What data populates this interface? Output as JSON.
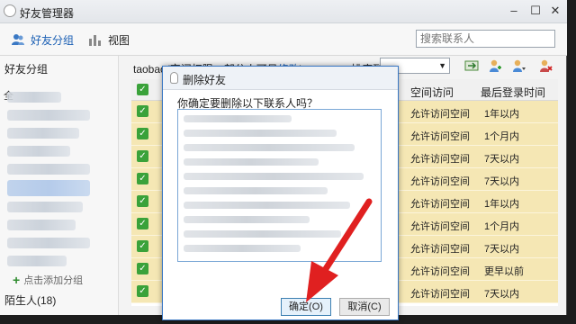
{
  "window": {
    "title": "好友管理器",
    "minimize": "–",
    "maximize": "☐",
    "close": "✕"
  },
  "toolbar": {
    "groups_label": "好友分组",
    "view_label": "视图",
    "search_placeholder": "搜索联系人"
  },
  "sidebar": {
    "heading": "好友分组",
    "partial_top": "全",
    "add_group": "点击添加分组",
    "stranger": "陌生人(18)"
  },
  "main": {
    "info_prefix": "taobao(空间权限：部分人可见",
    "info_link": "修改",
    "info_suffix": ")",
    "sort_label": "排序到",
    "sort_value": ""
  },
  "table": {
    "columns": {
      "space": "空间访问",
      "last_login": "最后登录时间"
    },
    "rows": [
      {
        "checked": true,
        "space": "允许访问空间",
        "last_login": "1年以内"
      },
      {
        "checked": true,
        "space": "允许访问空间",
        "last_login": "1个月内"
      },
      {
        "checked": true,
        "space": "允许访问空间",
        "last_login": "7天以内"
      },
      {
        "checked": true,
        "space": "允许访问空间",
        "last_login": "7天以内"
      },
      {
        "checked": true,
        "space": "允许访问空间",
        "last_login": "1年以内"
      },
      {
        "checked": true,
        "space": "允许访问空间",
        "last_login": "1个月内"
      },
      {
        "checked": true,
        "space": "允许访问空间",
        "last_login": "7天以内"
      },
      {
        "checked": true,
        "space": "允许访问空间",
        "last_login": "更早以前"
      },
      {
        "checked": true,
        "space": "允许访问空间",
        "last_login": "7天以内"
      }
    ]
  },
  "dialog": {
    "title": "删除好友",
    "question": "你确定要删除以下联系人吗？",
    "ok": "确定(O)",
    "cancel": "取消(C)"
  },
  "colors": {
    "row_highlight": "#f5e7b4",
    "accent": "#3a78c4",
    "arrow": "#e02020",
    "checkbox": "#3aa23a"
  }
}
